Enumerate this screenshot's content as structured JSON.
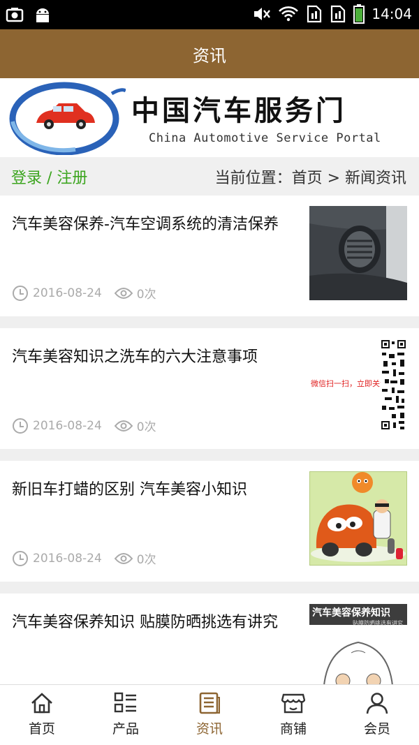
{
  "status_bar": {
    "time": "14:04"
  },
  "header": {
    "title": "资讯"
  },
  "banner": {
    "cn_title": "中国汽车服务门",
    "en_title": "China Automotive Service Portal"
  },
  "location_bar": {
    "login_label": "登录 / 注册",
    "breadcrumb": "当前位置：首页 > 新闻资讯"
  },
  "news": [
    {
      "title": "汽车美容保养-汽车空调系统的清洁保养",
      "date": "2016-08-24",
      "views": "0次"
    },
    {
      "title": "汽车美容知识之洗车的六大注意事项",
      "date": "2016-08-24",
      "views": "0次",
      "thumb_text": "微信扫一扫，立即关注 →→→"
    },
    {
      "title": "新旧车打蜡的区别 汽车美容小知识",
      "date": "2016-08-24",
      "views": "0次"
    },
    {
      "title": "汽车美容保养知识 贴膜防晒挑选有讲究",
      "date": "",
      "views": "",
      "thumb_text": "汽车美容保养知识",
      "thumb_subtext": "贴膜防晒挑选有讲究"
    }
  ],
  "tab_bar": {
    "items": [
      {
        "label": "首页",
        "icon": "home-icon"
      },
      {
        "label": "产品",
        "icon": "list-icon"
      },
      {
        "label": "资讯",
        "icon": "document-icon",
        "active": true
      },
      {
        "label": "商铺",
        "icon": "store-icon"
      },
      {
        "label": "会员",
        "icon": "person-icon"
      }
    ]
  },
  "colors": {
    "accent": "#8d6532",
    "login_green": "#3ca51f",
    "meta_gray": "#aaaaaa"
  }
}
